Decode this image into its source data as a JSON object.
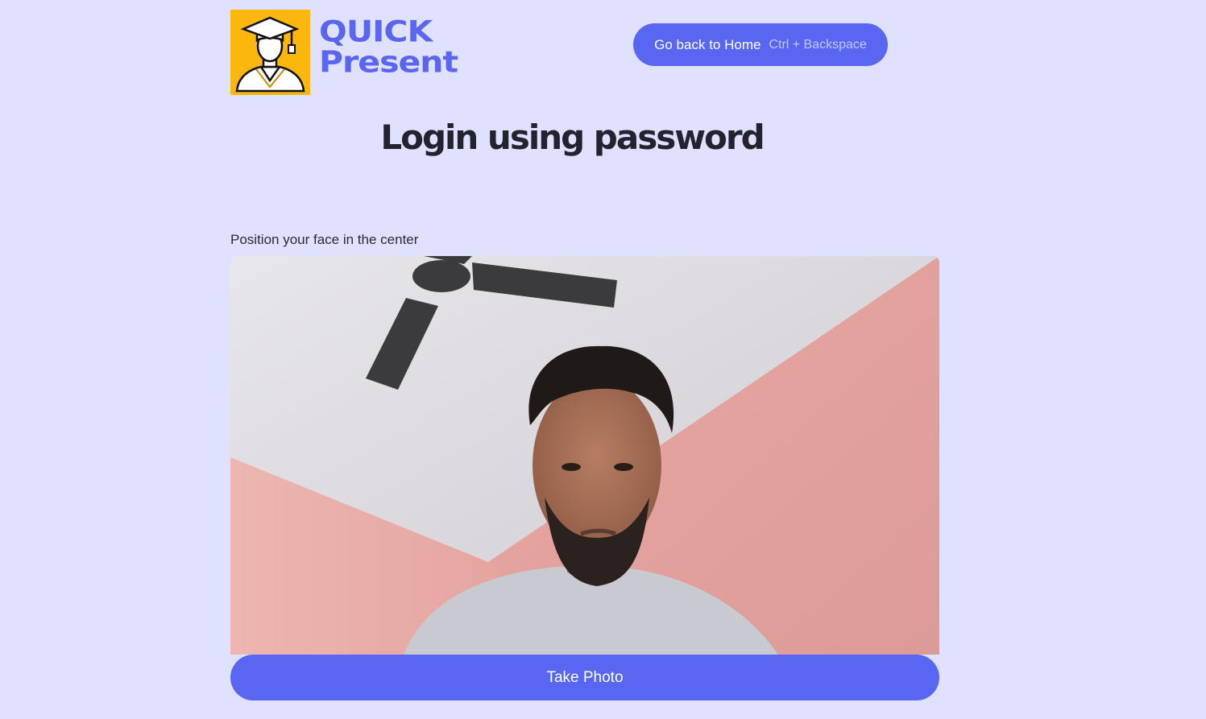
{
  "brand": {
    "line1": "QUICK",
    "line2": "Present",
    "logo_icon": "graduate-icon",
    "accent_color": "#5a66f0",
    "logo_bg_color": "#fbb70c"
  },
  "header": {
    "home_button_label": "Go back to Home",
    "home_button_shortcut": "Ctrl + Backspace"
  },
  "main": {
    "title": "Login using password",
    "camera_hint": "Position your face in the center",
    "take_photo_label": "Take Photo"
  }
}
